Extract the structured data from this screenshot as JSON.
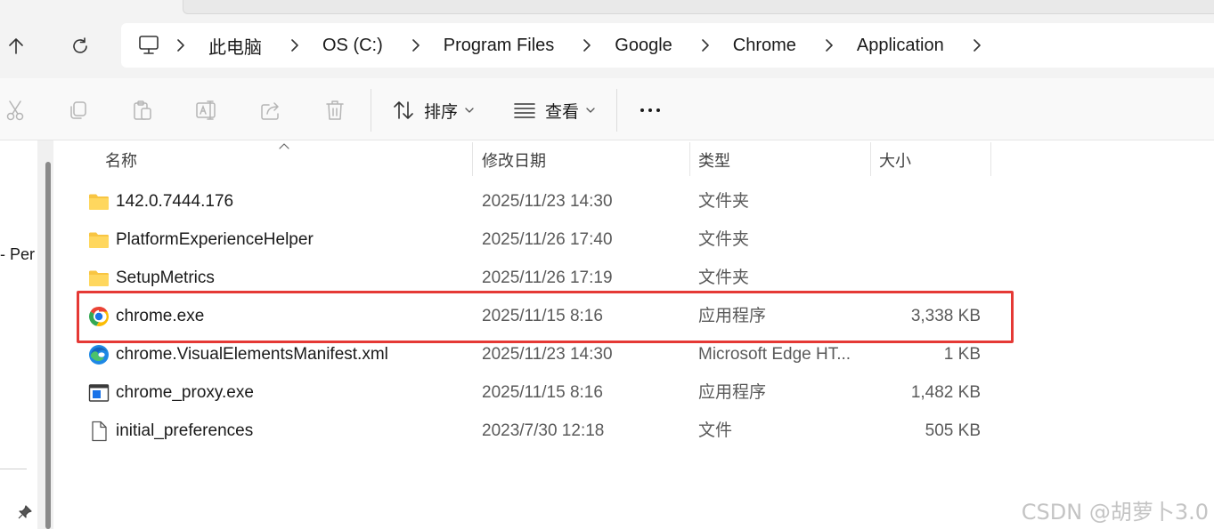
{
  "navigation": {
    "up_icon": "arrow-up-icon",
    "refresh_icon": "refresh-icon",
    "address_icon": "this-pc-icon",
    "breadcrumbs": [
      "此电脑",
      "OS (C:)",
      "Program Files",
      "Google",
      "Chrome",
      "Application"
    ]
  },
  "toolbar": {
    "icons": [
      "cut-icon",
      "copy-icon",
      "paste-icon",
      "rename-icon",
      "share-icon",
      "delete-icon"
    ],
    "sort_label": "排序",
    "view_label": "查看",
    "more_icon": "more-icon"
  },
  "left_panel": {
    "partial_text": "- Per"
  },
  "columns": {
    "name": "名称",
    "modified": "修改日期",
    "type": "类型",
    "size": "大小"
  },
  "files": [
    {
      "name": "142.0.7444.176",
      "modified": "2025/11/23 14:30",
      "type": "文件夹",
      "size": "",
      "icon": "folder-icon"
    },
    {
      "name": "PlatformExperienceHelper",
      "modified": "2025/11/26 17:40",
      "type": "文件夹",
      "size": "",
      "icon": "folder-icon"
    },
    {
      "name": "SetupMetrics",
      "modified": "2025/11/26 17:19",
      "type": "文件夹",
      "size": "",
      "icon": "folder-icon"
    },
    {
      "name": "chrome.exe",
      "modified": "2025/11/15 8:16",
      "type": "应用程序",
      "size": "3,338 KB",
      "icon": "chrome-icon",
      "highlighted": true
    },
    {
      "name": "chrome.VisualElementsManifest.xml",
      "modified": "2025/11/23 14:30",
      "type": "Microsoft Edge HT...",
      "size": "1 KB",
      "icon": "edge-icon"
    },
    {
      "name": "chrome_proxy.exe",
      "modified": "2025/11/15 8:16",
      "type": "应用程序",
      "size": "1,482 KB",
      "icon": "application-icon"
    },
    {
      "name": "initial_preferences",
      "modified": "2023/7/30 12:18",
      "type": "文件",
      "size": "505 KB",
      "icon": "file-icon"
    }
  ],
  "watermark": "CSDN @胡萝卜3.0",
  "colors": {
    "highlight_border": "#e53935",
    "folder": "#f8c542"
  }
}
